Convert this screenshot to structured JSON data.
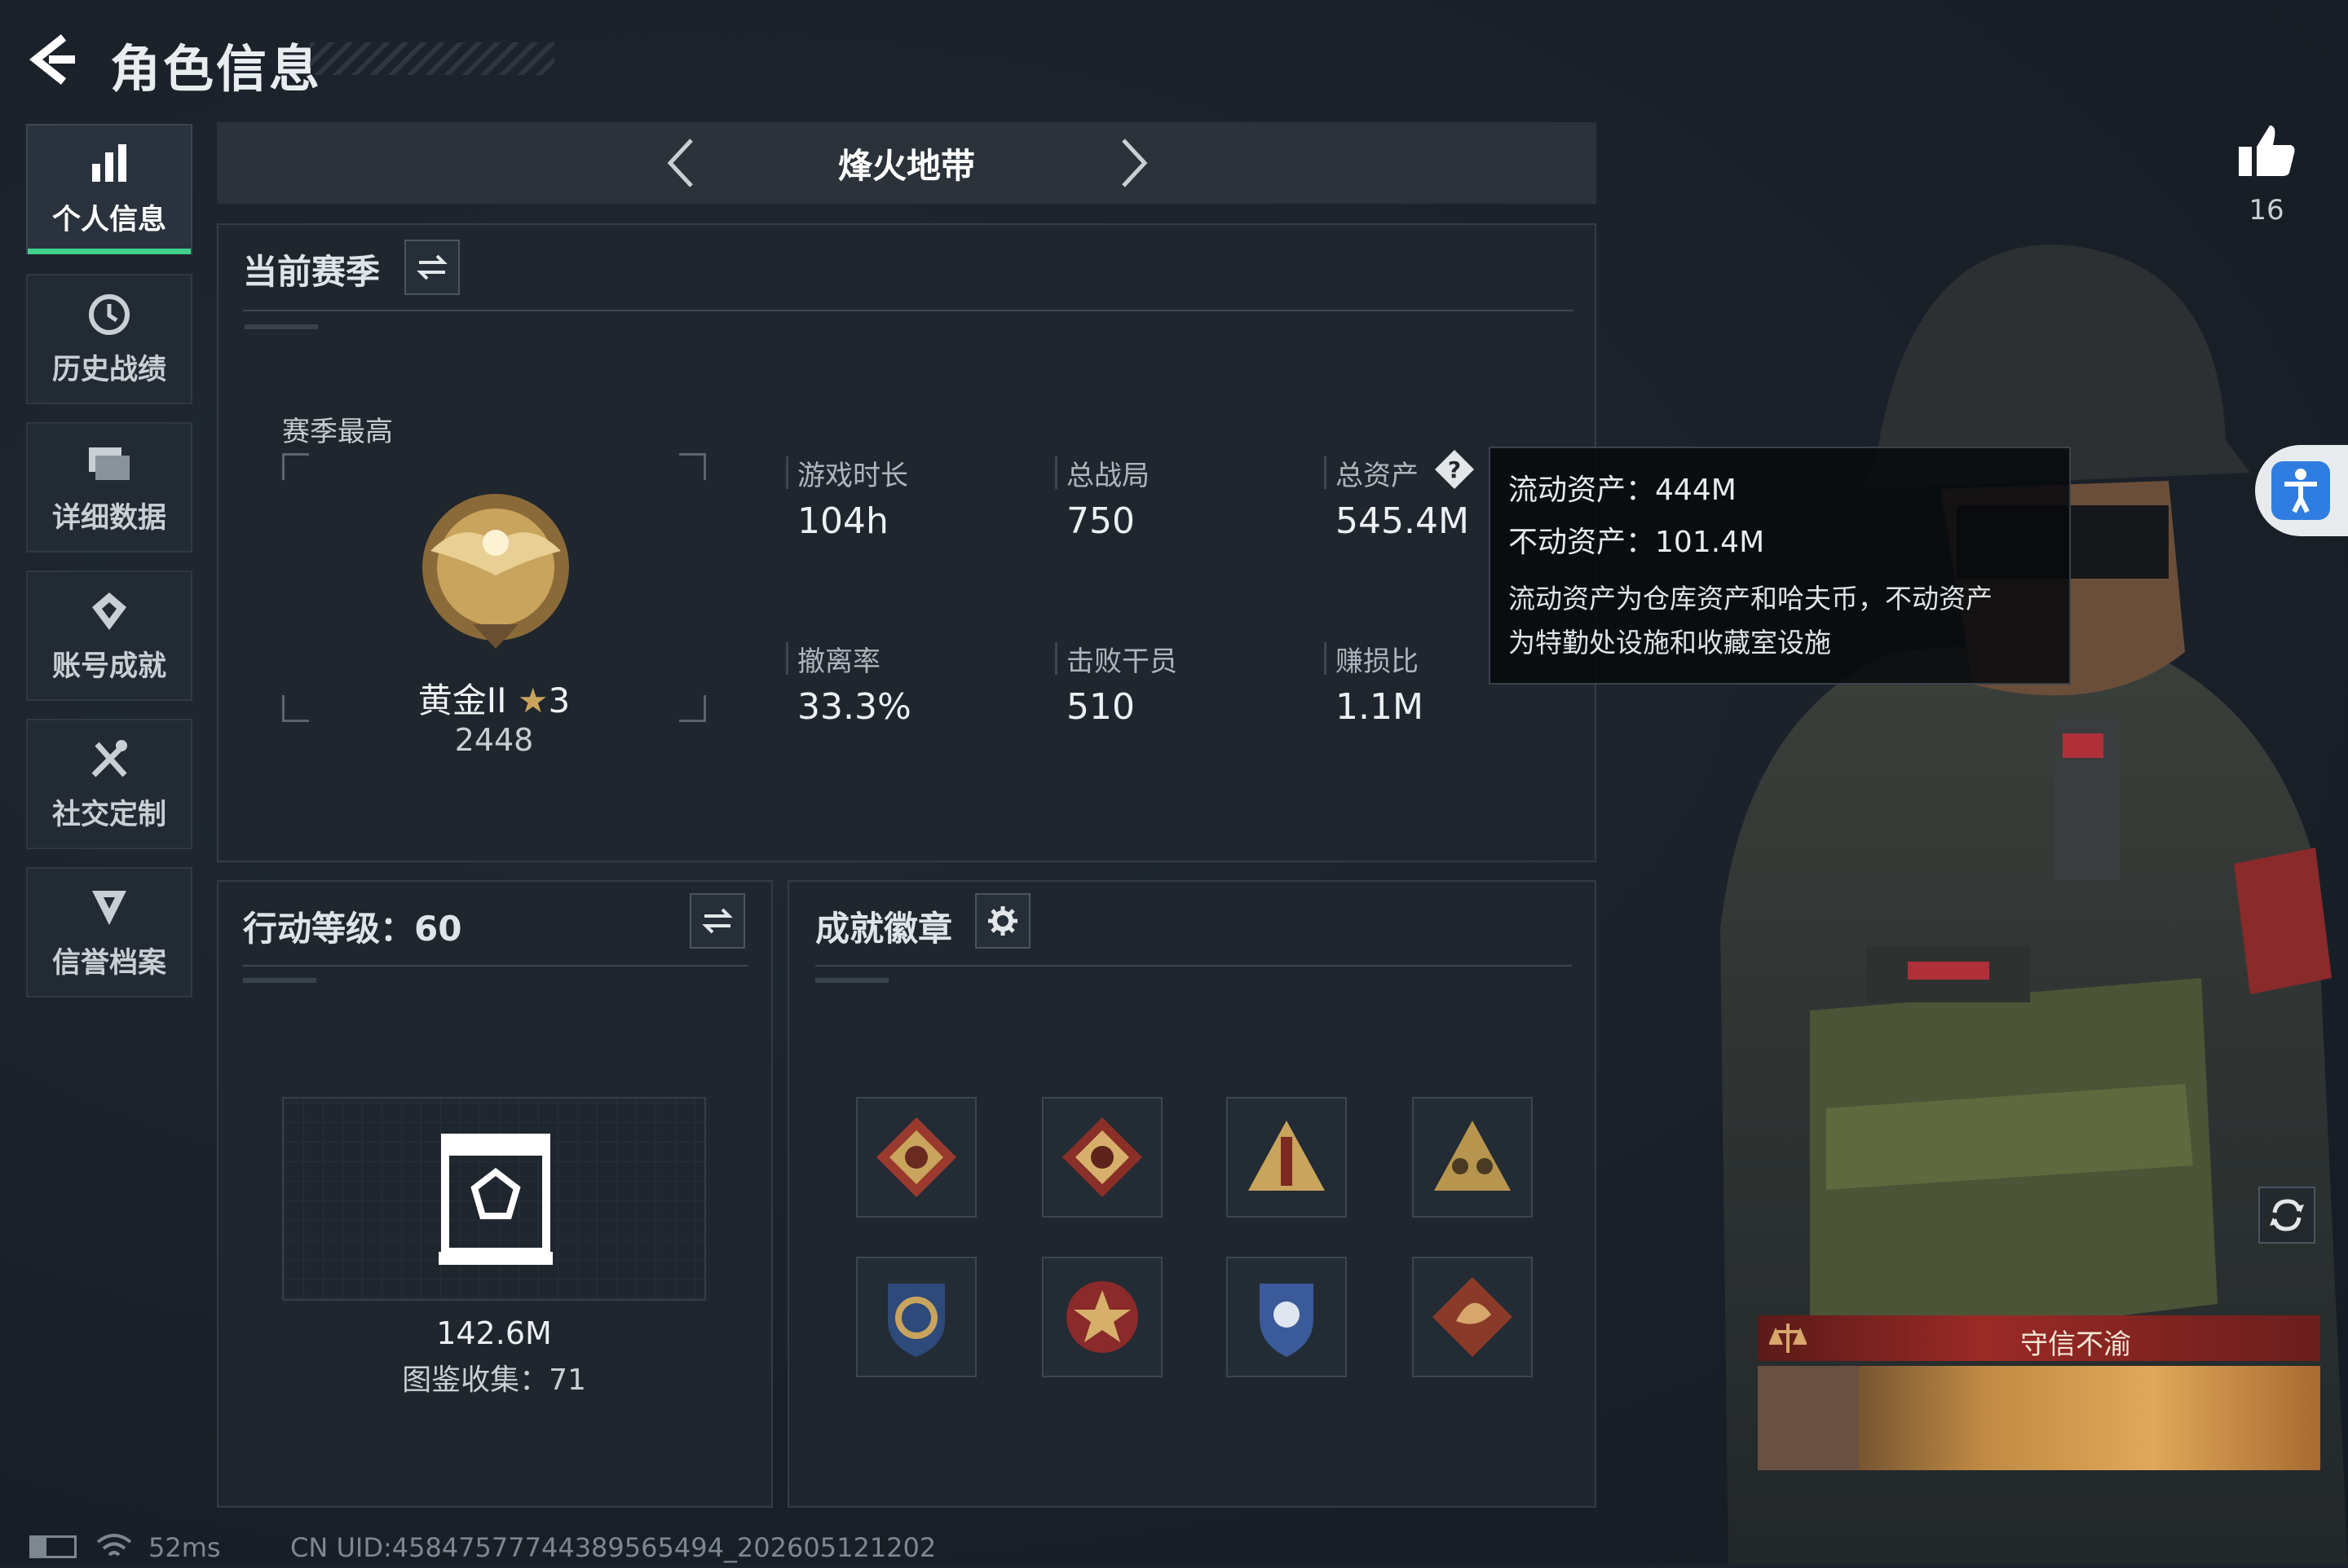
{
  "header": {
    "title": "角色信息"
  },
  "sidebar": {
    "items": [
      {
        "label": "个人信息",
        "icon": "bar-chart-icon",
        "active": true
      },
      {
        "label": "历史战绩",
        "icon": "clock-history-icon",
        "active": false
      },
      {
        "label": "详细数据",
        "icon": "folder-icon",
        "active": false
      },
      {
        "label": "账号成就",
        "icon": "achievement-icon",
        "active": false
      },
      {
        "label": "社交定制",
        "icon": "tools-icon",
        "active": false
      },
      {
        "label": "信誉档案",
        "icon": "shield-credit-icon",
        "active": false
      }
    ]
  },
  "mode_selector": {
    "current": "烽火地带"
  },
  "season": {
    "header": "当前赛季",
    "best_label": "赛季最高",
    "rank_name": "黄金II",
    "rank_stars": "3",
    "rank_score": "2448",
    "stats": [
      {
        "label": "游戏时长",
        "value": "104h"
      },
      {
        "label": "总战局",
        "value": "750"
      },
      {
        "label": "总资产",
        "value": "545.4M"
      },
      {
        "label": "撤离率",
        "value": "33.3%"
      },
      {
        "label": "击败干员",
        "value": "510"
      },
      {
        "label": "赚损比",
        "value": "1.1M"
      }
    ]
  },
  "tooltip": {
    "liquid_label": "流动资产：",
    "liquid_value": "444M",
    "fixed_label": "不动资产：",
    "fixed_value": "101.4M",
    "note_line1": "流动资产为仓库资产和哈夫币，不动资产",
    "note_line2": "为特勤处设施和收藏室设施"
  },
  "action_level": {
    "header": "行动等级：60",
    "collection_value": "142.6M",
    "collection_label": "图鉴收集：71"
  },
  "achievements": {
    "header": "成就徽章",
    "badges": [
      "wolf-badge",
      "wolf-badge-2",
      "tower-badge",
      "squad-badge",
      "anchor-shield-badge",
      "star-wreath-badge",
      "eagle-shield-badge",
      "dragon-badge"
    ]
  },
  "likes": {
    "count": "16"
  },
  "card": {
    "title": "守信不渝"
  },
  "footer": {
    "ping": "52ms",
    "uid": "CN UID:4584757774438956549​4_202605121202"
  },
  "colors": {
    "accent": "#3fd08a",
    "panel": "#1f262e",
    "background": "#1b222b",
    "gold": "#c9a45c",
    "card_red": "#9a2a26"
  }
}
